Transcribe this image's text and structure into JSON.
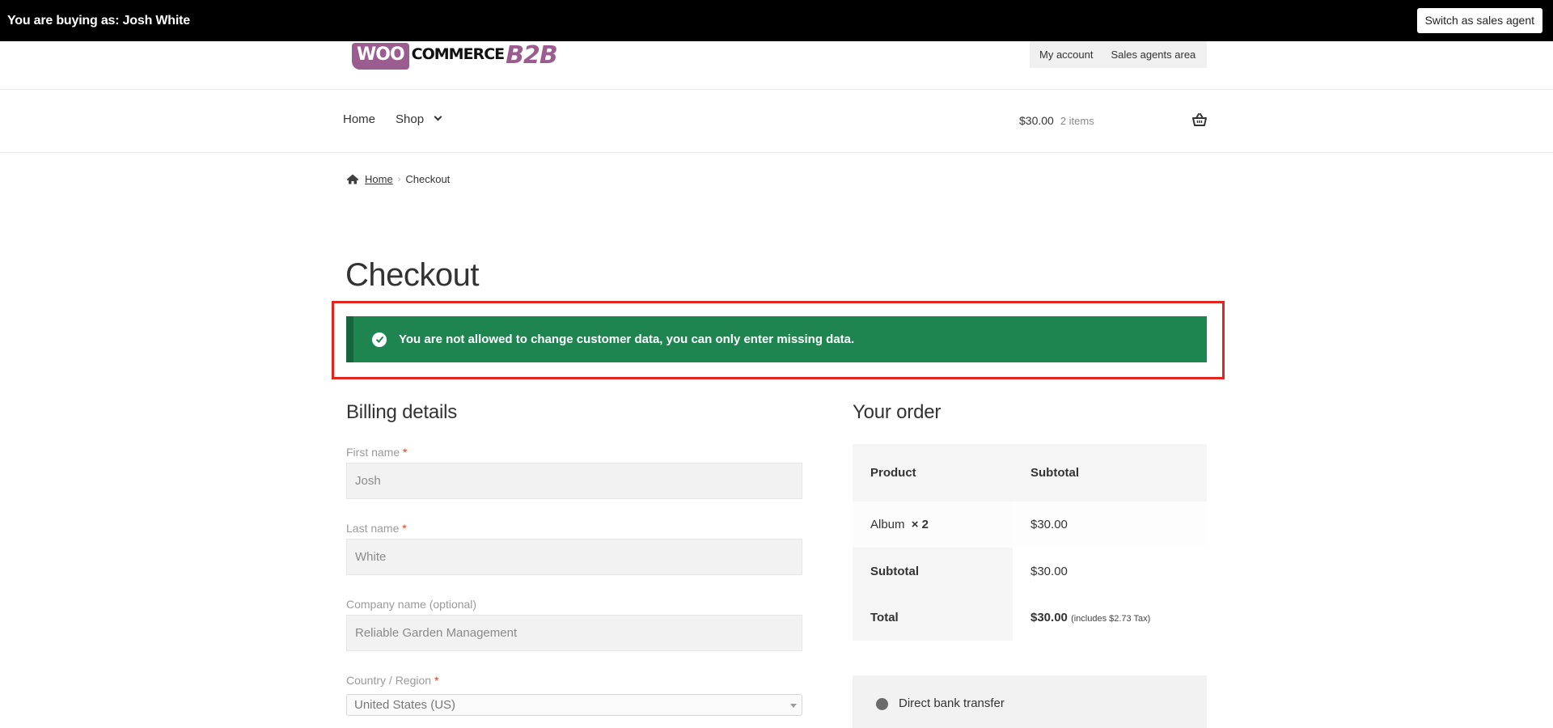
{
  "agent_bar": {
    "buying_as": "You are buying as: Josh White",
    "switch_label": "Switch as sales agent"
  },
  "header": {
    "logo": {
      "woo": "WOO",
      "commerce": "COMMERCE",
      "b2b": "B2B"
    },
    "account_links": [
      "My account",
      "Sales agents area"
    ],
    "nav": [
      "Home",
      "Shop"
    ],
    "cart": {
      "amount": "$30.00",
      "items": "2 items"
    }
  },
  "breadcrumb": {
    "home": "Home",
    "current": "Checkout"
  },
  "page_title": "Checkout",
  "notice": {
    "message": "You are not allowed to change customer data, you can only enter missing data.",
    "color": "#1e8550"
  },
  "billing": {
    "title": "Billing details",
    "fields": [
      {
        "label": "First name",
        "required": true,
        "value": "Josh"
      },
      {
        "label": "Last name",
        "required": true,
        "value": "White"
      },
      {
        "label": "Company name (optional)",
        "required": false,
        "value": "Reliable Garden Management"
      },
      {
        "label": "Country / Region",
        "required": true,
        "value": "United States (US)"
      }
    ]
  },
  "order": {
    "title": "Your order",
    "headers": {
      "product": "Product",
      "subtotal": "Subtotal"
    },
    "item": {
      "name": "Album",
      "qty": "× 2",
      "subtotal": "$30.00"
    },
    "subtotal": {
      "label": "Subtotal",
      "value": "$30.00"
    },
    "total": {
      "label": "Total",
      "value": "$30.00",
      "tax_note": "(includes $2.73 Tax)"
    }
  },
  "payment": {
    "method": "Direct bank transfer"
  }
}
